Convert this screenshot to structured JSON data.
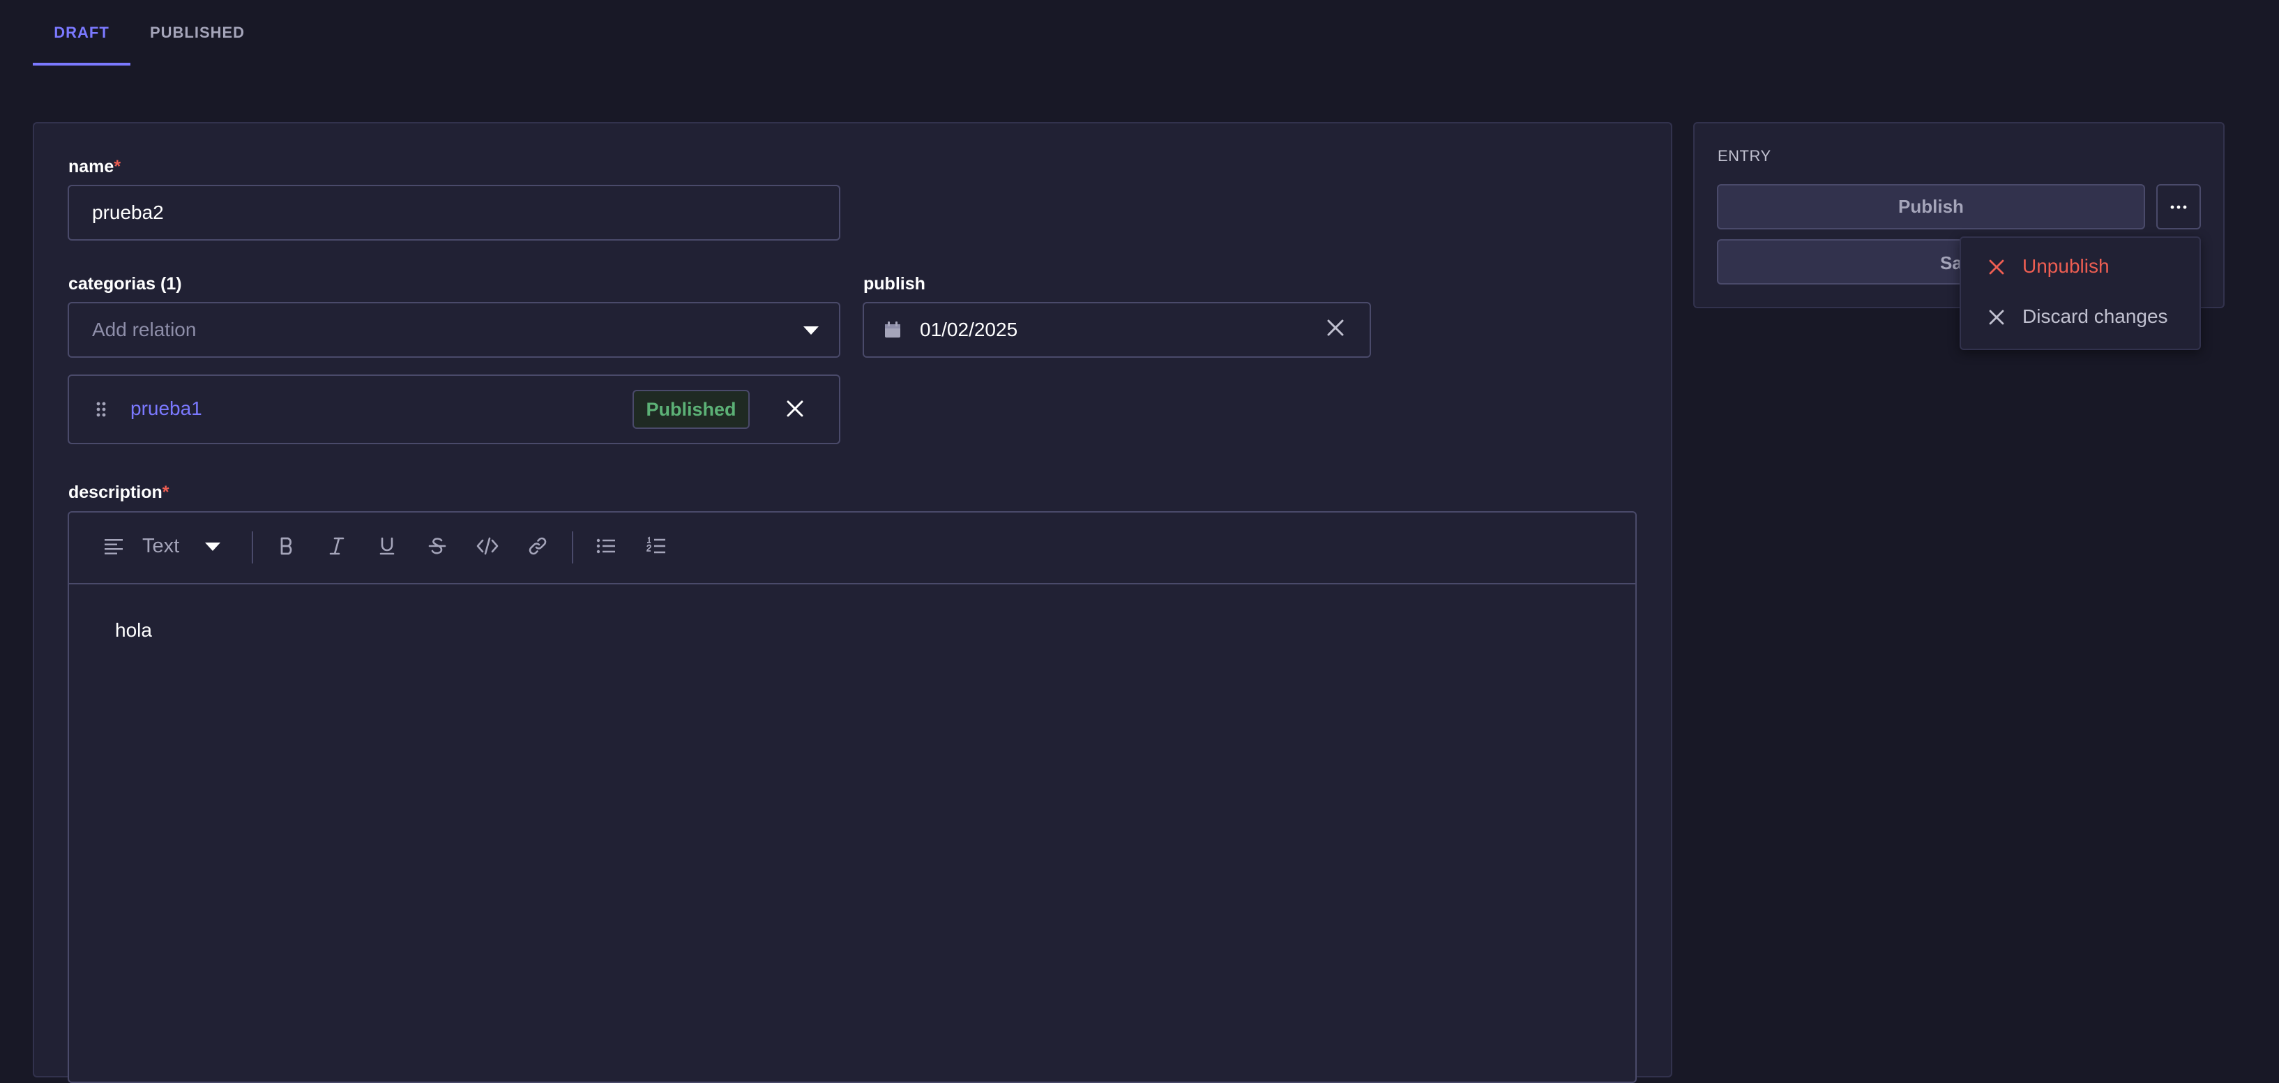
{
  "tabs": {
    "draft": "DRAFT",
    "published": "PUBLISHED"
  },
  "form": {
    "name": {
      "label": "name",
      "required_mark": "*",
      "value": "prueba2"
    },
    "categorias": {
      "label": "categorias (1)",
      "placeholder": "Add relation",
      "relation": {
        "name": "prueba1",
        "status": "Published"
      }
    },
    "publish": {
      "label": "publish",
      "value": "01/02/2025"
    },
    "description": {
      "label": "description",
      "required_mark": "*",
      "toolbar": {
        "block_type": "Text"
      },
      "content": "hola"
    }
  },
  "entry": {
    "heading": "ENTRY",
    "publish_button": "Publish",
    "save_button_visible": "Sa",
    "menu": {
      "unpublish": "Unpublish",
      "discard": "Discard changes"
    }
  },
  "colors": {
    "accent": "#7b79ff",
    "danger": "#ee5e52",
    "success": "#5cb176",
    "background": "#181826",
    "panel": "#212134"
  }
}
